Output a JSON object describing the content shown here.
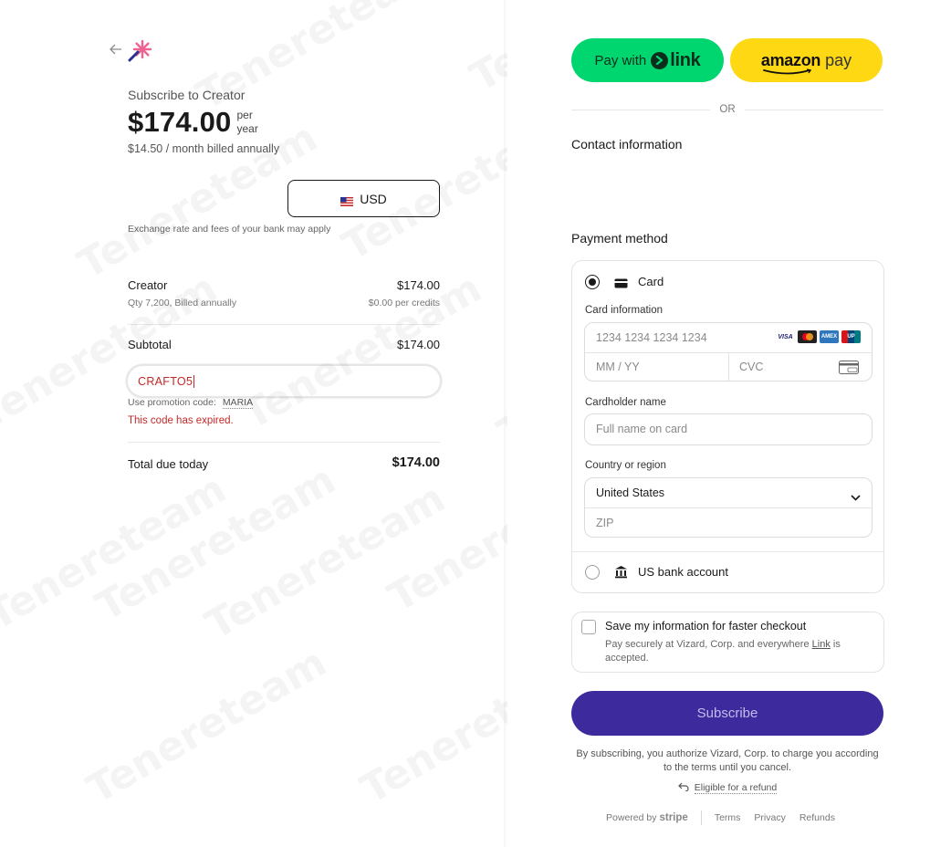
{
  "summary": {
    "back_icon": "arrow-left-icon",
    "logo_icon": "sparkle-logo",
    "subscribe_title": "Subscribe to Creator",
    "price": "$174.00",
    "per_line1": "per",
    "per_line2": "year",
    "monthly_note": "$14.50 / month billed annually",
    "currency_label": "USD",
    "currency_flag_icon": "us-flag-icon",
    "exchange_note": "Exchange rate and fees of your bank may apply",
    "line_item": {
      "name": "Creator",
      "detail": "Qty 7,200, Billed annually",
      "amount": "$174.00",
      "unit_price": "$0.00 per credits"
    },
    "subtotal_label": "Subtotal",
    "subtotal_amount": "$174.00",
    "promo_value": "CRAFTO5",
    "promo_hint_prefix": "Use promotion code:",
    "promo_hint_code": "MARIA",
    "promo_error": "This code has expired.",
    "total_label": "Total due today",
    "total_amount": "$174.00"
  },
  "watermark": {
    "text": "Tenereteam"
  },
  "checkout": {
    "link_button": {
      "prefix": "Pay with",
      "word": "link"
    },
    "amazon_button": {
      "word": "amazon",
      "suffix": "pay"
    },
    "or_text": "OR",
    "contact_title": "Contact information",
    "payment_title": "Payment method",
    "card_option": "Card",
    "card_info_label": "Card information",
    "card_number_placeholder": "1234 1234 1234 1234",
    "brands": [
      {
        "name": "visa",
        "label": "VISA",
        "color": "#1a1f71"
      },
      {
        "name": "mastercard",
        "label": "MC",
        "color": "#eb001b"
      },
      {
        "name": "amex",
        "label": "AMEX",
        "color": "#2e77bc"
      },
      {
        "name": "unionpay",
        "label": "UP",
        "color": "#d7141a"
      }
    ],
    "expiry_placeholder": "MM / YY",
    "cvc_placeholder": "CVC",
    "cardholder_label": "Cardholder name",
    "cardholder_placeholder": "Full name on card",
    "country_label": "Country or region",
    "country_value": "United States",
    "zip_placeholder": "ZIP",
    "bank_option": "US bank account",
    "save_title": "Save my information for faster checkout",
    "save_sub_prefix": "Pay securely at Vizard, Corp. and everywhere",
    "save_sub_link": "Link",
    "save_sub_suffix": "is accepted.",
    "subscribe_label": "Subscribe",
    "terms_note": "By subscribing, you authorize Vizard, Corp. to charge you according to the terms until you cancel.",
    "refund_label": "Eligible for a refund",
    "powered_by": "Powered by",
    "stripe": "stripe",
    "footer_links": [
      "Terms",
      "Privacy",
      "Refunds"
    ]
  },
  "colors": {
    "link_green": "#00d66f",
    "amazon_yellow": "#ffd814",
    "subscribe_purple": "#3d2a9c",
    "error_red": "#c62828"
  }
}
